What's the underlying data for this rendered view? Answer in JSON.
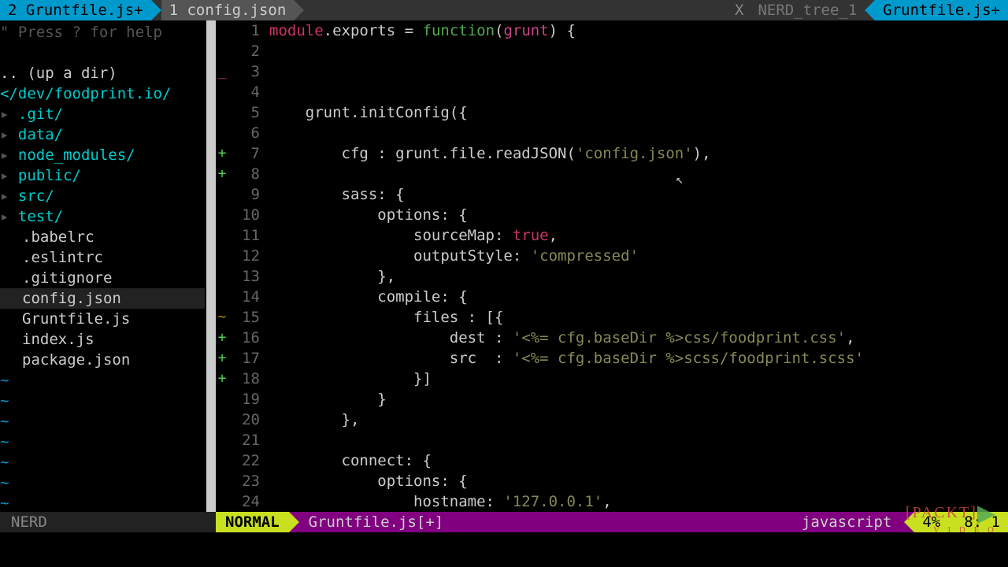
{
  "tabs": {
    "left1": "2 Gruntfile.js+",
    "left2": "1 config.json",
    "right_x": "X",
    "right_inactive": "NERD_tree_1",
    "right_active": "Gruntfile.js+"
  },
  "sidebar": {
    "help": "\" Press ? for help",
    "updir": ".. (up a dir)",
    "root": "</dev/foodprint.io/",
    "folders": [
      ".git/",
      "data/",
      "node_modules/",
      "public/",
      "src/",
      "test/"
    ],
    "files": [
      ".babelrc",
      ".eslintrc",
      ".gitignore",
      "config.json",
      "Gruntfile.js",
      "index.js",
      "package.json"
    ],
    "selected_file": "config.json"
  },
  "editor": {
    "lines": [
      {
        "n": 1,
        "sign": "",
        "tokens": [
          {
            "t": "module",
            "c": "kw"
          },
          {
            "t": ".",
            "c": "punct"
          },
          {
            "t": "exports",
            "c": "ident"
          },
          {
            "t": " = ",
            "c": "punct"
          },
          {
            "t": "function",
            "c": "fn"
          },
          {
            "t": "(",
            "c": "punct"
          },
          {
            "t": "grunt",
            "c": "param"
          },
          {
            "t": ") {",
            "c": "punct"
          }
        ]
      },
      {
        "n": 2,
        "sign": "",
        "tokens": []
      },
      {
        "n": 3,
        "sign": "del",
        "tokens": []
      },
      {
        "n": 4,
        "sign": "",
        "tokens": []
      },
      {
        "n": 5,
        "sign": "",
        "tokens": [
          {
            "t": "    grunt.initConfig({",
            "c": "ident"
          }
        ]
      },
      {
        "n": 6,
        "sign": "",
        "tokens": []
      },
      {
        "n": 7,
        "sign": "+",
        "tokens": [
          {
            "t": "        cfg : grunt.file.readJSON(",
            "c": "ident"
          },
          {
            "t": "'config.json'",
            "c": "str"
          },
          {
            "t": "),",
            "c": "punct"
          }
        ]
      },
      {
        "n": 8,
        "sign": "+",
        "tokens": []
      },
      {
        "n": 9,
        "sign": "",
        "tokens": [
          {
            "t": "        sass: {",
            "c": "ident"
          }
        ]
      },
      {
        "n": 10,
        "sign": "",
        "tokens": [
          {
            "t": "            options: {",
            "c": "ident"
          }
        ]
      },
      {
        "n": 11,
        "sign": "",
        "tokens": [
          {
            "t": "                sourceMap: ",
            "c": "ident"
          },
          {
            "t": "true",
            "c": "bool"
          },
          {
            "t": ",",
            "c": "punct"
          }
        ]
      },
      {
        "n": 12,
        "sign": "",
        "tokens": [
          {
            "t": "                outputStyle: ",
            "c": "ident"
          },
          {
            "t": "'compressed'",
            "c": "str"
          }
        ]
      },
      {
        "n": 13,
        "sign": "",
        "tokens": [
          {
            "t": "            },",
            "c": "ident"
          }
        ]
      },
      {
        "n": 14,
        "sign": "",
        "tokens": [
          {
            "t": "            compile: {",
            "c": "ident"
          }
        ]
      },
      {
        "n": 15,
        "sign": "~",
        "tokens": [
          {
            "t": "                files : [{",
            "c": "ident"
          }
        ]
      },
      {
        "n": 16,
        "sign": "+",
        "tokens": [
          {
            "t": "                    dest : ",
            "c": "ident"
          },
          {
            "t": "'<%= cfg.baseDir %>css/foodprint.css'",
            "c": "str"
          },
          {
            "t": ",",
            "c": "punct"
          }
        ]
      },
      {
        "n": 17,
        "sign": "+",
        "tokens": [
          {
            "t": "                    src  : ",
            "c": "ident"
          },
          {
            "t": "'<%= cfg.baseDir %>scss/foodprint.scss'",
            "c": "str"
          }
        ]
      },
      {
        "n": 18,
        "sign": "+",
        "tokens": [
          {
            "t": "                }]",
            "c": "ident"
          }
        ]
      },
      {
        "n": 19,
        "sign": "",
        "tokens": [
          {
            "t": "            }",
            "c": "ident"
          }
        ]
      },
      {
        "n": 20,
        "sign": "",
        "tokens": [
          {
            "t": "        },",
            "c": "ident"
          }
        ]
      },
      {
        "n": 21,
        "sign": "",
        "tokens": []
      },
      {
        "n": 22,
        "sign": "",
        "tokens": [
          {
            "t": "        connect: {",
            "c": "ident"
          }
        ]
      },
      {
        "n": 23,
        "sign": "",
        "tokens": [
          {
            "t": "            options: {",
            "c": "ident"
          }
        ]
      },
      {
        "n": 24,
        "sign": "",
        "tokens": [
          {
            "t": "                hostname: ",
            "c": "ident"
          },
          {
            "t": "'127.0.0.1'",
            "c": "str"
          },
          {
            "t": ",",
            "c": "punct"
          }
        ]
      }
    ]
  },
  "status": {
    "nerd": "NERD",
    "mode": "NORMAL",
    "file": "Gruntfile.js[+]",
    "filetype": "javascript",
    "percent": "4%",
    "lncol": "8:  1"
  },
  "watermark": {
    "brand": "[PACKT]",
    "sub": "V I D E O"
  }
}
